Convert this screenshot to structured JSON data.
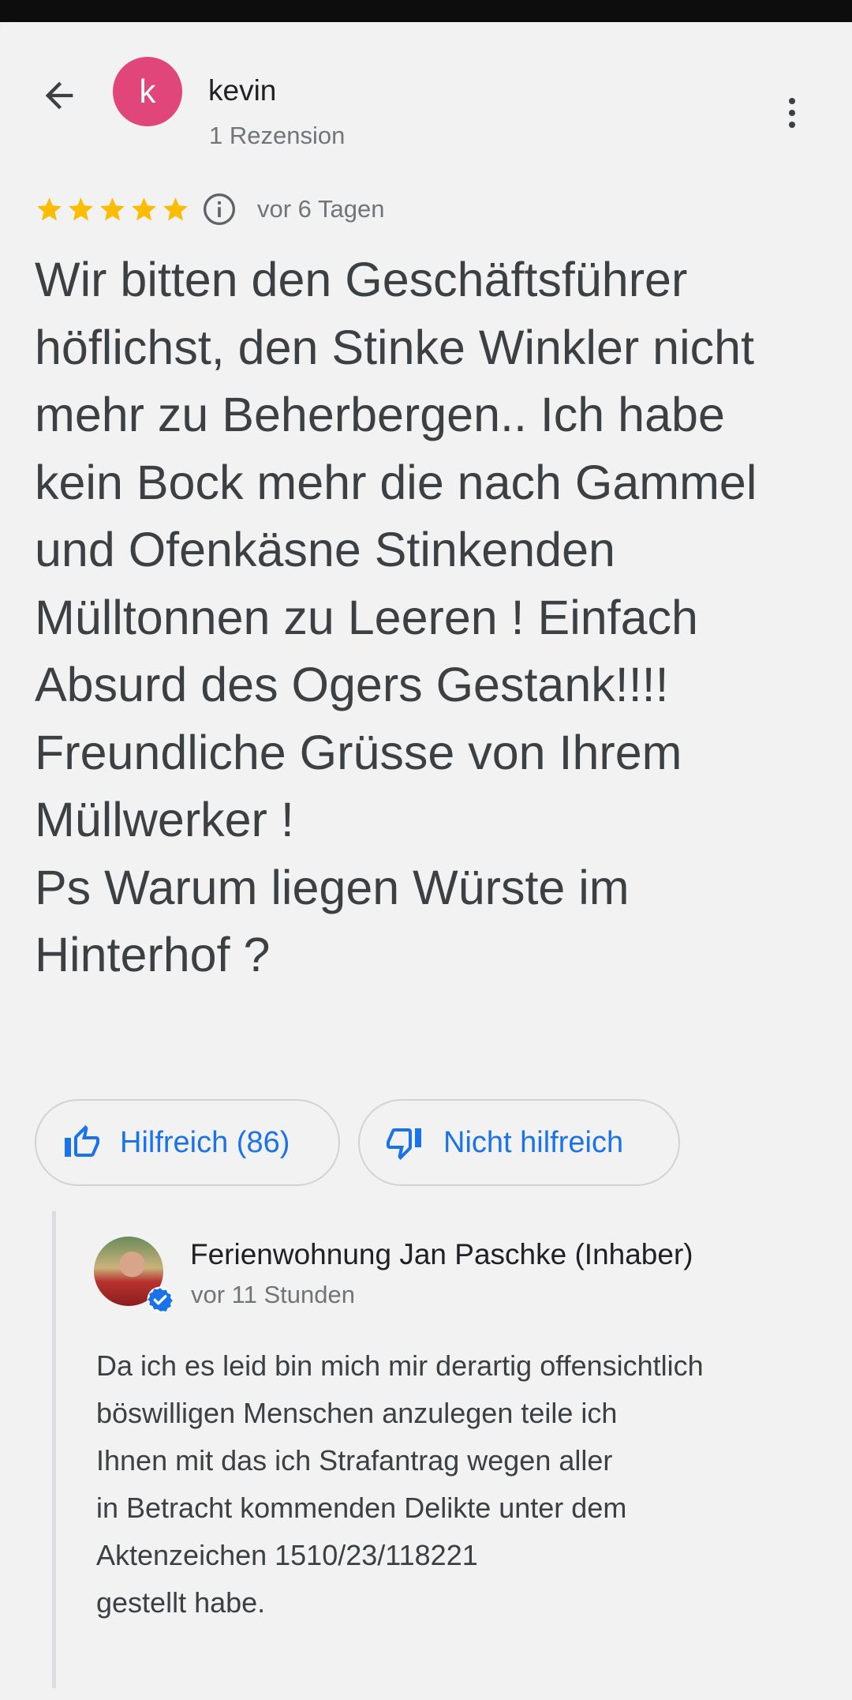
{
  "header": {
    "reviewer_initial": "k",
    "reviewer_name": "kevin",
    "reviewer_review_count": "1 Rezension",
    "avatar_color": "#e0467a"
  },
  "review": {
    "rating": 5,
    "rating_max": 5,
    "date": "vor 6 Tagen",
    "text": "Wir bitten den Geschäftsführer höflichst, den Stinke Winkler nicht mehr zu Beherbergen.. Ich habe kein Bock mehr die nach Gammel und Ofenkäsne Stinkenden Mülltonnen zu Leeren ! Einfach Absurd des Ogers Gestank!!!!\nFreundliche Grüsse von Ihrem Müllwerker !\nPs Warum liegen Würste im Hinterhof ?",
    "star_color": "#fbbc04"
  },
  "votes": {
    "helpful_label": "Hilfreich (86)",
    "not_helpful_label": "Nicht hilfreich",
    "accent_color": "#1a73e8"
  },
  "owner_reply": {
    "name": "Ferienwohnung Jan Paschke (Inhaber)",
    "date": "vor 11 Stunden",
    "text": "Da ich es leid bin mich mir derartig offensichtlich böswilligen Menschen anzulegen teile ich\nIhnen mit das ich Strafantrag wegen aller\nin Betracht kommenden Delikte unter dem\nAktenzeichen 1510/23/118221\ngestellt habe.",
    "verified_color": "#1a73e8"
  },
  "icons": {
    "back": "arrow-left-icon",
    "more": "more-vert-icon",
    "star": "star-icon",
    "info": "info-icon",
    "thumbs_up": "thumbs-up-icon",
    "thumbs_down": "thumbs-down-icon",
    "verified": "verified-badge-icon"
  }
}
